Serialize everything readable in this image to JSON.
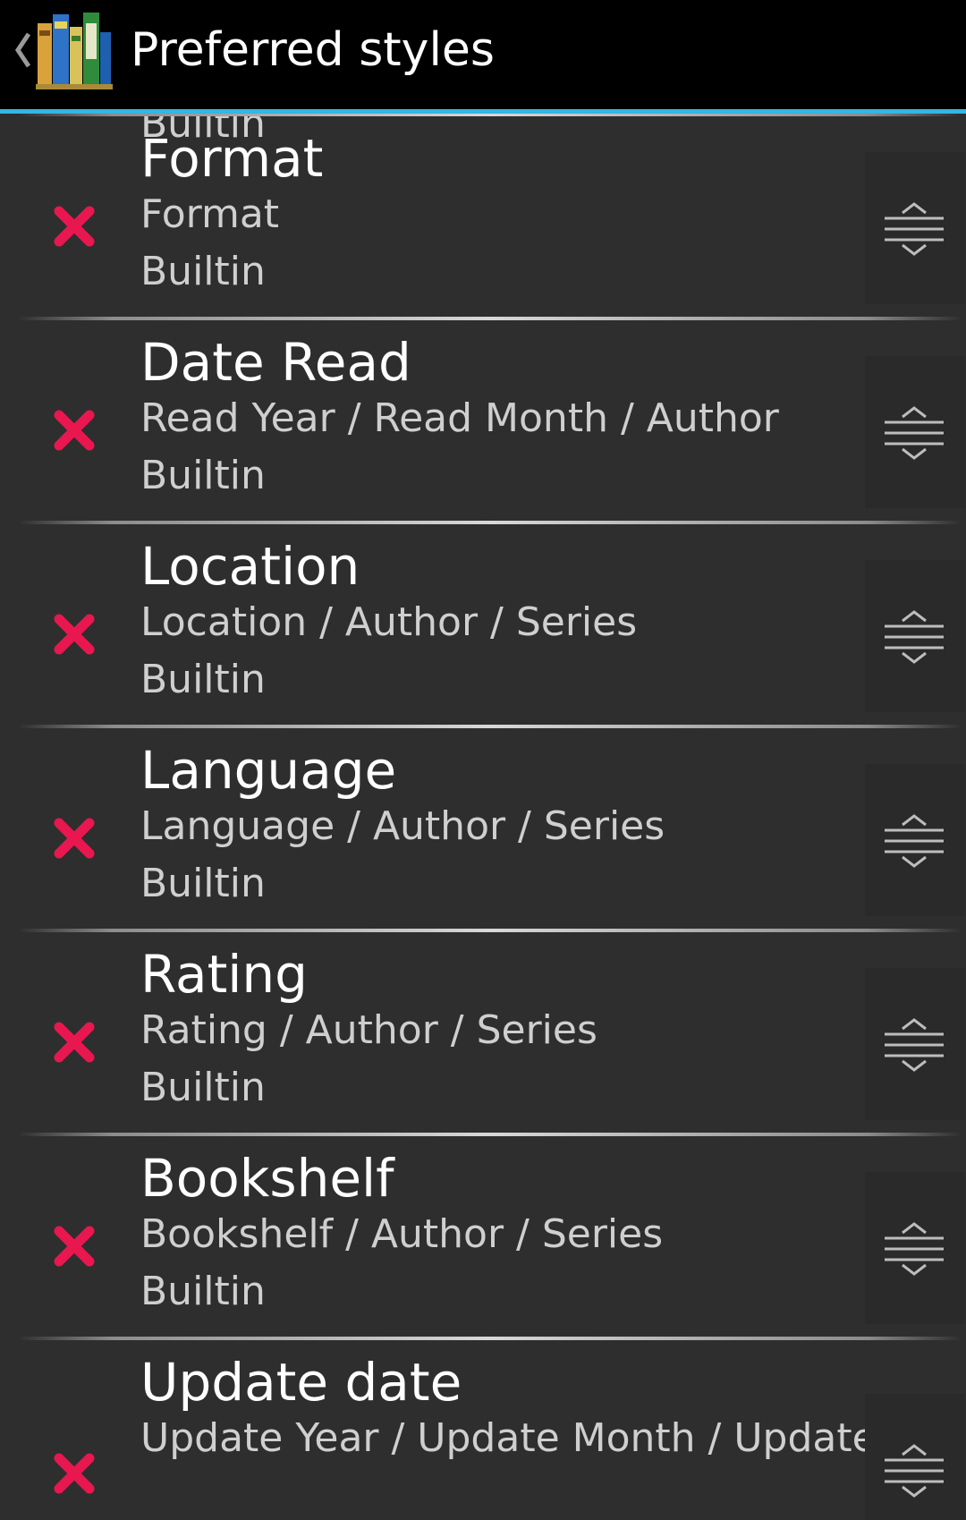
{
  "header": {
    "title": "Preferred styles",
    "back_icon": "chevron-left-icon",
    "app_icon": "books-icon"
  },
  "colors": {
    "accent": "#33b5e5",
    "delete": "#e8174f",
    "background": "#2e2e2e",
    "actionbar": "#000000"
  },
  "list": {
    "top_partial_kind": "Builtin",
    "items": [
      {
        "name": "Format",
        "description": "Format",
        "kind": "Builtin"
      },
      {
        "name": "Date Read",
        "description": "Read Year / Read Month / Author",
        "kind": "Builtin"
      },
      {
        "name": "Location",
        "description": "Location / Author / Series",
        "kind": "Builtin"
      },
      {
        "name": "Language",
        "description": "Language / Author / Series",
        "kind": "Builtin"
      },
      {
        "name": "Rating",
        "description": "Rating / Author / Series",
        "kind": "Builtin"
      },
      {
        "name": "Bookshelf",
        "description": "Bookshelf / Author / Series",
        "kind": "Builtin"
      },
      {
        "name": "Update date",
        "description": "Update Year / Update Month / Update",
        "kind": ""
      }
    ]
  }
}
